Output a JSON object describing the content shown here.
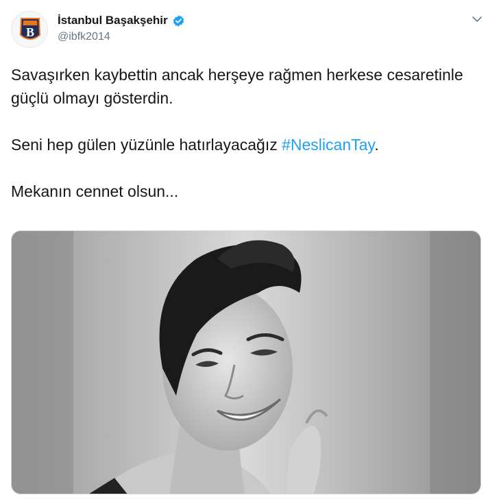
{
  "account": {
    "display_name": "İstanbul Başakşehir",
    "handle": "@ibfk2014",
    "verified": true,
    "avatar_icon": "basaksehir-crest-icon",
    "avatar_letter": "B"
  },
  "tweet": {
    "line1": "Savaşırken kaybettin ancak herşeye rağmen herkese cesaretinle güçlü olmayı gösterdin.",
    "line2_text": "Seni hep gülen yüzünle hatırlayacağız ",
    "line2_hashtag": "#NeslicanTay",
    "line2_end": ".",
    "line3": "Mekanın cennet olsun..."
  },
  "media": {
    "type": "photo",
    "style": "black-and-white portrait"
  },
  "colors": {
    "link": "#1da1f2",
    "verified": "#1da1f2",
    "text": "#14171a",
    "muted": "#657786"
  }
}
